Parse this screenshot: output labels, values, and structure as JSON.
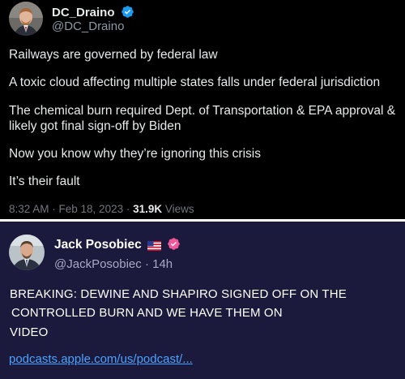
{
  "first_post": {
    "author_name": "DC_Draino",
    "author_handle": "@DC_Draino",
    "lines": [
      "Railways are governed by federal law",
      "A toxic cloud affecting multiple states falls under federal jurisdiction",
      "The chemical burn required Dept. of Transportation & EPA approval &",
      "likely got final sign-off by Biden",
      "Now you know why they’re ignoring this crisis",
      "It’s their fault"
    ],
    "timestamp": "8:32 AM · Feb 18, 2023 · ",
    "view_count": "31.9K",
    "views_label": " Views",
    "verified_icon": "verified-check-icon",
    "accent_color": "#1d9bf0"
  },
  "second_post": {
    "author_name": "Jack Posobiec",
    "author_handle": "@JackPosobiec · 14h",
    "flag_icon": "us-flag-icon",
    "badge_icon": "pink-verified-badge-icon",
    "text_lines": [
      "BREAKING: DEWINE AND SHAPIRO SIGNED OFF ON THE",
      "CONTROLLED BURN AND WE HAVE THEM ON",
      "VIDEO"
    ],
    "link_text": "podcasts.apple.com/us/podcast/...",
    "background_color": "#1b1a3d",
    "link_color": "#4aa3ff"
  }
}
